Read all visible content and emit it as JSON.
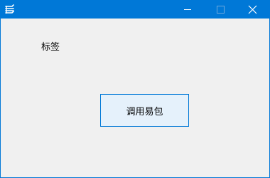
{
  "window": {
    "title": "",
    "icon": "app-logo-icon",
    "controls": {
      "minimize_icon": "minimize-icon",
      "maximize_icon": "maximize-icon",
      "close_icon": "close-icon"
    }
  },
  "form": {
    "label_text": "标签",
    "button_label": "调用易包"
  },
  "colors": {
    "titlebar": "#0078d7",
    "client_background": "#f0f0f0",
    "button_background": "#e5f1fb",
    "button_border": "#0078d7"
  }
}
